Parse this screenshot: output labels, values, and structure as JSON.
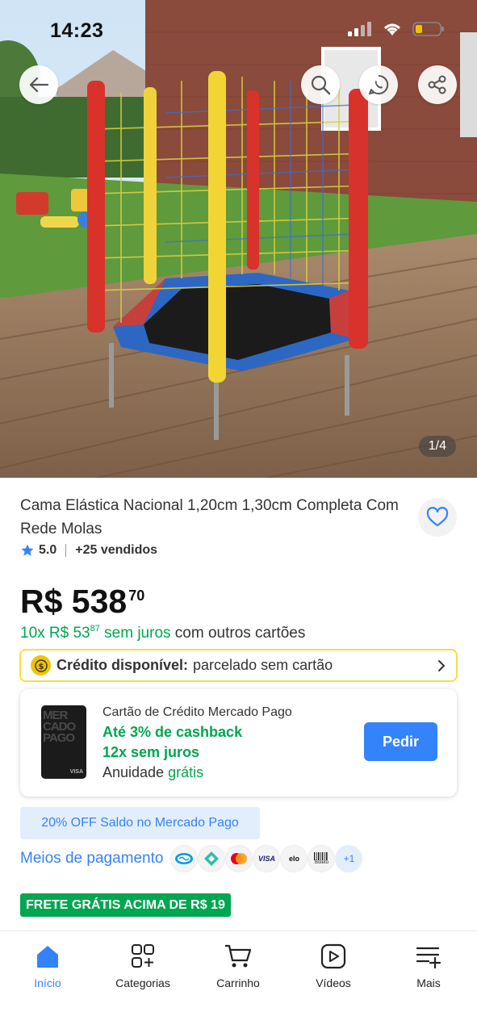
{
  "status_bar": {
    "time": "14:23"
  },
  "gallery": {
    "counter": "1/4"
  },
  "product": {
    "title": "Cama Elástica Nacional 1,20cm 1,30cm Completa Com Rede Molas",
    "rating": "5.0",
    "sold": "+25 vendidos",
    "price_main": "R$ 538",
    "price_cents": "70",
    "installments": {
      "count": "10x R$ 53",
      "cents": "87",
      "interest": "sem juros",
      "suffix": "com outros cartões"
    }
  },
  "credit": {
    "bold": "Crédito disponível:",
    "text": "parcelado sem cartão"
  },
  "mp_card": {
    "title": "Cartão de Crédito Mercado Pago",
    "cashback": "Até 3% de cashback",
    "installments": "12x sem juros",
    "annuity_label": "Anuidade",
    "annuity_value": "grátis",
    "button": "Pedir",
    "card_brand": "MER CADO PAGO",
    "card_network": "VISA"
  },
  "discount": "20% OFF Saldo no Mercado Pago",
  "payments": {
    "label": "Meios de pagamento",
    "methods": [
      "mercado-pago",
      "pix",
      "mastercard",
      "VISA",
      "elo",
      "Boleto"
    ],
    "more": "+1"
  },
  "shipping_badge": "FRETE GRÁTIS ACIMA DE R$ 19",
  "nav": [
    {
      "label": "Início",
      "icon": "home-icon",
      "active": true
    },
    {
      "label": "Categorias",
      "icon": "categories-icon"
    },
    {
      "label": "Carrinho",
      "icon": "cart-icon"
    },
    {
      "label": "Vídeos",
      "icon": "video-icon"
    },
    {
      "label": "Mais",
      "icon": "more-menu-icon"
    }
  ],
  "colors": {
    "accent": "#3483fa",
    "green": "#00a650",
    "yellow_border": "#f6dd4a"
  }
}
